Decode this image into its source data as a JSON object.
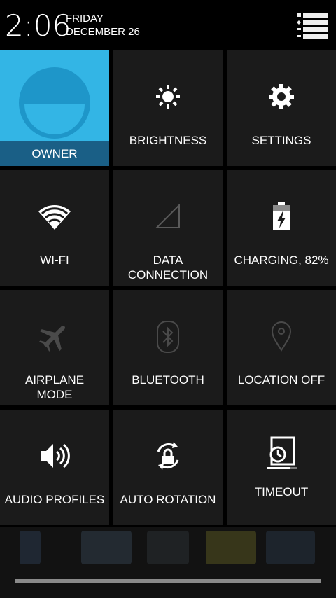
{
  "status": {
    "time": "2:06",
    "day": "FRIDAY",
    "date": "DECEMBER 26",
    "menu_icon": "list-settings-icon"
  },
  "tiles": [
    {
      "label": "OWNER",
      "icon": "user-avatar-icon"
    },
    {
      "label": "BRIGHTNESS",
      "icon": "brightness-icon"
    },
    {
      "label": "SETTINGS",
      "icon": "gear-icon"
    },
    {
      "label": "WI-FI",
      "icon": "wifi-icon"
    },
    {
      "label": "DATA\nCONNECTION",
      "icon": "signal-icon"
    },
    {
      "label": "CHARGING, 82%",
      "icon": "battery-charging-icon"
    },
    {
      "label": "AIRPLANE\nMODE",
      "icon": "airplane-icon"
    },
    {
      "label": "BLUETOOTH",
      "icon": "bluetooth-icon"
    },
    {
      "label": "LOCATION OFF",
      "icon": "location-pin-icon"
    },
    {
      "label": "AUDIO PROFILES",
      "icon": "speaker-icon"
    },
    {
      "label": "AUTO ROTATION",
      "icon": "rotation-lock-icon"
    },
    {
      "label": "TIMEOUT",
      "icon": "timeout-icon"
    }
  ],
  "colors": {
    "accent": "#33b5e5",
    "tile_bg": "#1b1b1b",
    "disabled_icon": "#4a4a4a"
  }
}
